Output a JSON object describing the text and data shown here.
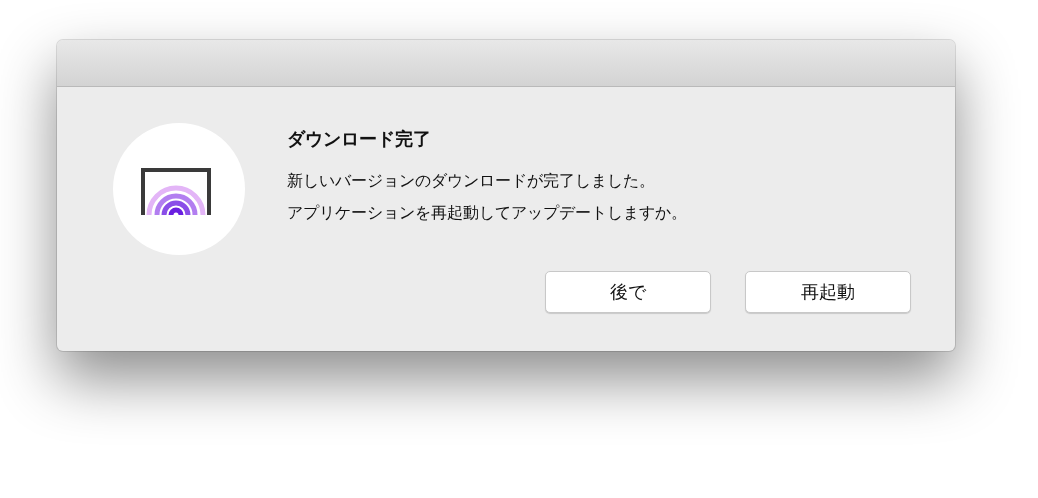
{
  "dialog": {
    "title": "ダウンロード完了",
    "message_lines": [
      "新しいバージョンのダウンロードが完了しました。",
      "アプリケーションを再起動してアップデートしますか。"
    ],
    "buttons": [
      {
        "label": "後で"
      },
      {
        "label": "再起動"
      }
    ]
  }
}
